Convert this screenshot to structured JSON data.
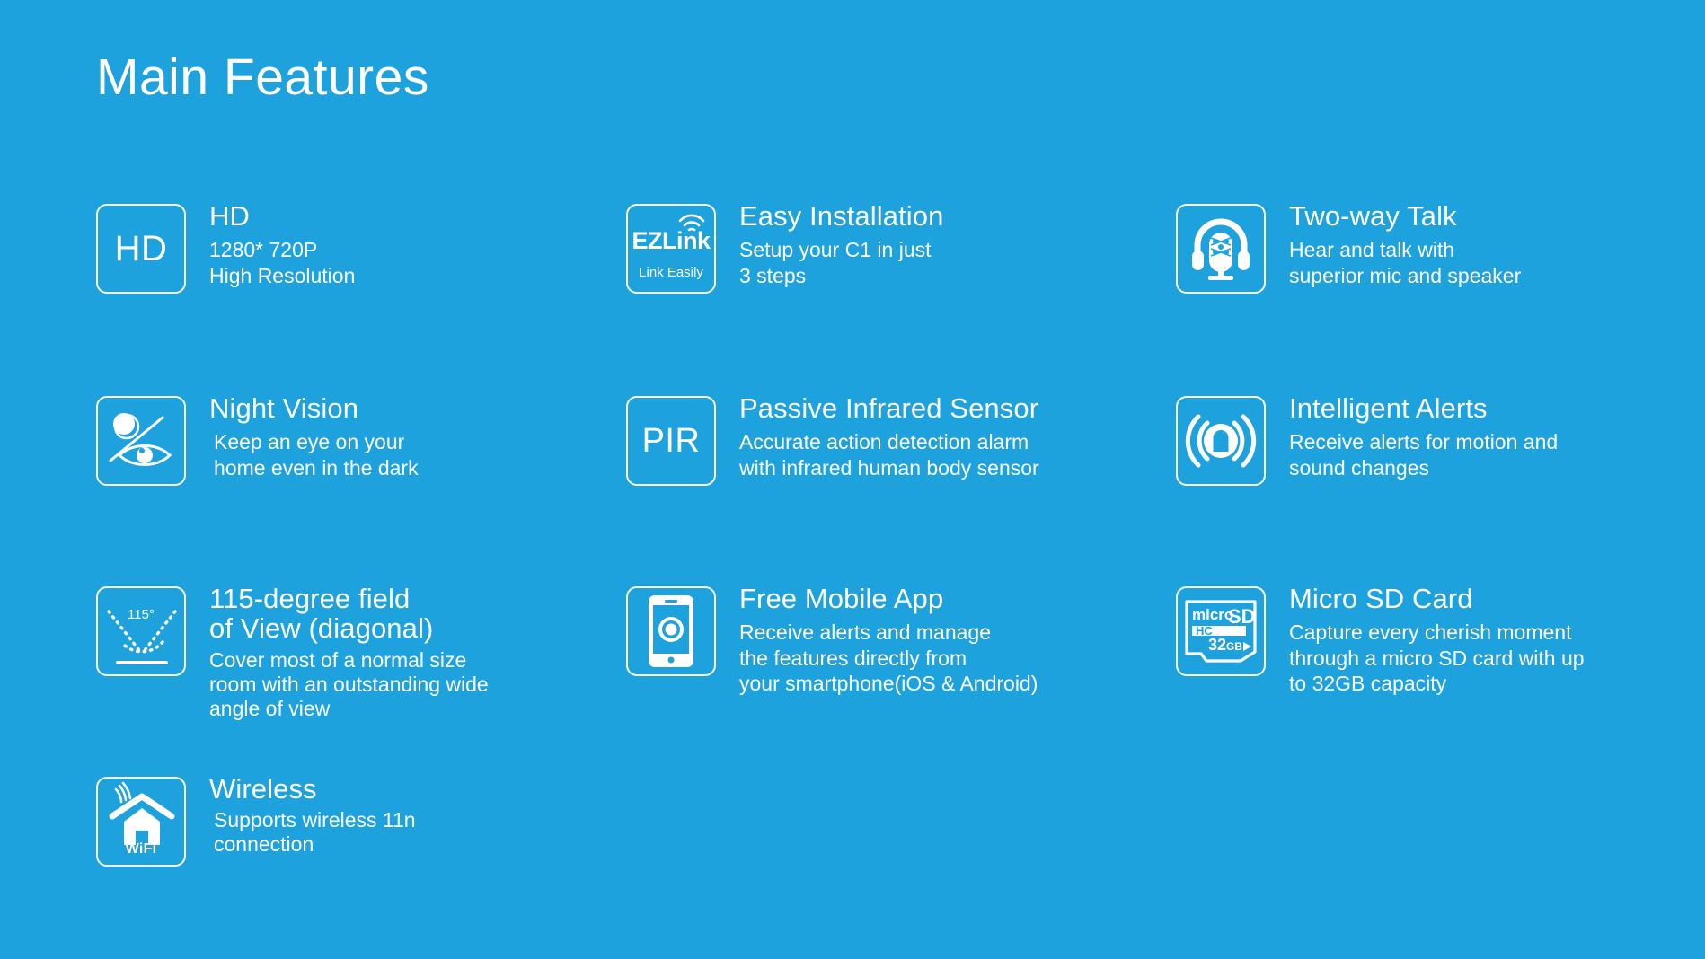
{
  "page": {
    "title": "Main Features",
    "background_color": "#1da2dd",
    "text_color": "#ffffff"
  },
  "features": [
    {
      "id": "hd",
      "icon_name": "hd-icon",
      "icon_text": "HD",
      "title": "HD",
      "description": "1280* 720P\nHigh Resolution"
    },
    {
      "id": "easy-installation",
      "icon_name": "ezlink-icon",
      "icon_text": "EZLink",
      "icon_subtext": "Link Easily",
      "title": "Easy Installation",
      "description": "Setup your C1 in just\n3 steps"
    },
    {
      "id": "two-way-talk",
      "icon_name": "headset-microphone-icon",
      "title": "Two-way Talk",
      "description": "Hear and talk with\nsuperior mic and speaker"
    },
    {
      "id": "night-vision",
      "icon_name": "night-vision-eye-icon",
      "title": "Night Vision",
      "description": "Keep an eye on your\nhome even in the dark"
    },
    {
      "id": "passive-infrared-sensor",
      "icon_name": "pir-icon",
      "icon_text": "PIR",
      "title": "Passive Infrared Sensor",
      "description": "Accurate action detection alarm\nwith infrared human body sensor"
    },
    {
      "id": "intelligent-alerts",
      "icon_name": "person-alert-waves-icon",
      "title": "Intelligent Alerts",
      "description": "Receive alerts for motion and\nsound changes"
    },
    {
      "id": "field-of-view",
      "icon_name": "field-of-view-angle-icon",
      "icon_text": "115°",
      "title": "115-degree field\n of View (diagonal)",
      "description": "Cover most of a normal size\nroom with an outstanding wide\nangle of view"
    },
    {
      "id": "free-mobile-app",
      "icon_name": "smartphone-icon",
      "title": "Free Mobile App",
      "description": "Receive alerts and manage\nthe features directly from\nyour smartphone(iOS & Android)"
    },
    {
      "id": "micro-sd-card",
      "icon_name": "micro-sd-card-icon",
      "icon_text_micro": "micro",
      "icon_text_sd": "SD",
      "icon_text_hc": "HC",
      "icon_text_capacity": "32",
      "icon_text_capacity_unit": "GB",
      "title": "Micro SD Card",
      "description": "Capture every cherish moment\nthrough a micro SD card with up\nto 32GB capacity"
    },
    {
      "id": "wireless",
      "icon_name": "wifi-house-icon",
      "icon_caption": "WiFi",
      "title": "Wireless",
      "description": "Supports wireless 11n\nconnection"
    }
  ]
}
